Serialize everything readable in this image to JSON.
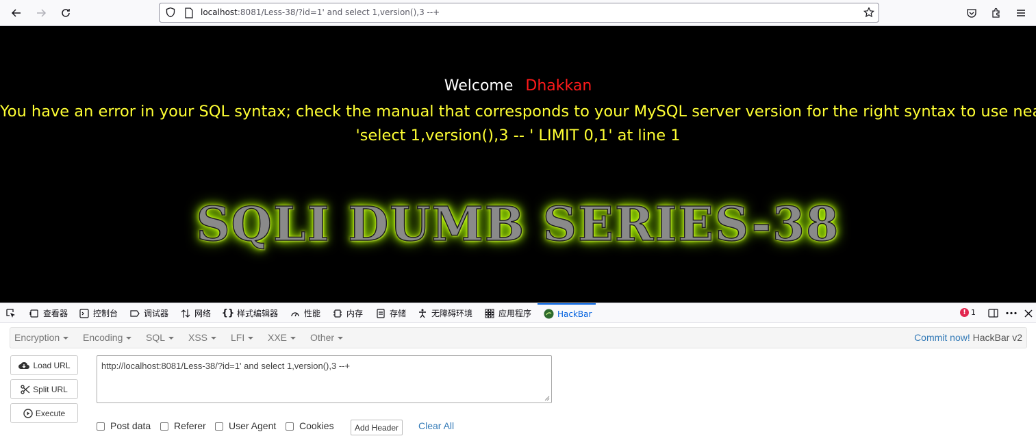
{
  "browser": {
    "url_host": "localhost",
    "url_rest": ":8081/Less-38/?id=1' and select 1,version(),3 --+"
  },
  "page": {
    "welcome_label": "Welcome",
    "user_name": "Dhakkan",
    "error_line1": "You have an error in your SQL syntax; check the manual that corresponds to your MySQL server version for the right syntax to use near",
    "error_line2": "'select 1,version(),3 -- ' LIMIT 0,1' at line 1",
    "banner": "SQLI DUMB SERIES-38"
  },
  "devtools": {
    "tabs": [
      "查看器",
      "控制台",
      "调试器",
      "网络",
      "样式编辑器",
      "性能",
      "内存",
      "存储",
      "无障碍环境",
      "应用程序",
      "HackBar"
    ],
    "error_count": "1"
  },
  "hackbar": {
    "menu": [
      "Encryption",
      "Encoding",
      "SQL",
      "XSS",
      "LFI",
      "XXE",
      "Other"
    ],
    "commit_link": "Commit now!",
    "version": "HackBar v2",
    "buttons": {
      "load": "Load URL",
      "split": "Split URL",
      "execute": "Execute"
    },
    "url_value": "http://localhost:8081/Less-38/?id=1' and select 1,version(),3 --+",
    "options": [
      "Post data",
      "Referer",
      "User Agent",
      "Cookies"
    ],
    "add_header": "Add Header",
    "clear_all": "Clear All"
  }
}
